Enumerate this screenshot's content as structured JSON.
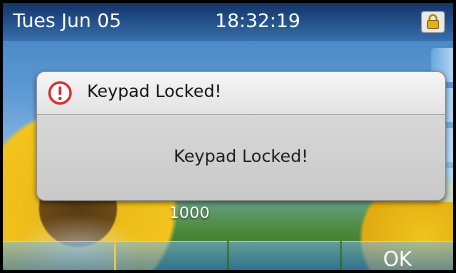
{
  "status_bar": {
    "date": "Tues Jun 05",
    "time": "18:32:19",
    "lock_icon": "lock-icon"
  },
  "dialog": {
    "icon": "alert-icon",
    "title": "Keypad Locked!",
    "message": "Keypad Locked!"
  },
  "account": {
    "label": "1000"
  },
  "softkeys": [
    "",
    "",
    "",
    "OK"
  ],
  "colors": {
    "status_bar": "#1e4f8f",
    "dialog_bg": "#d3d3d3",
    "alert_red": "#d92c2c"
  }
}
